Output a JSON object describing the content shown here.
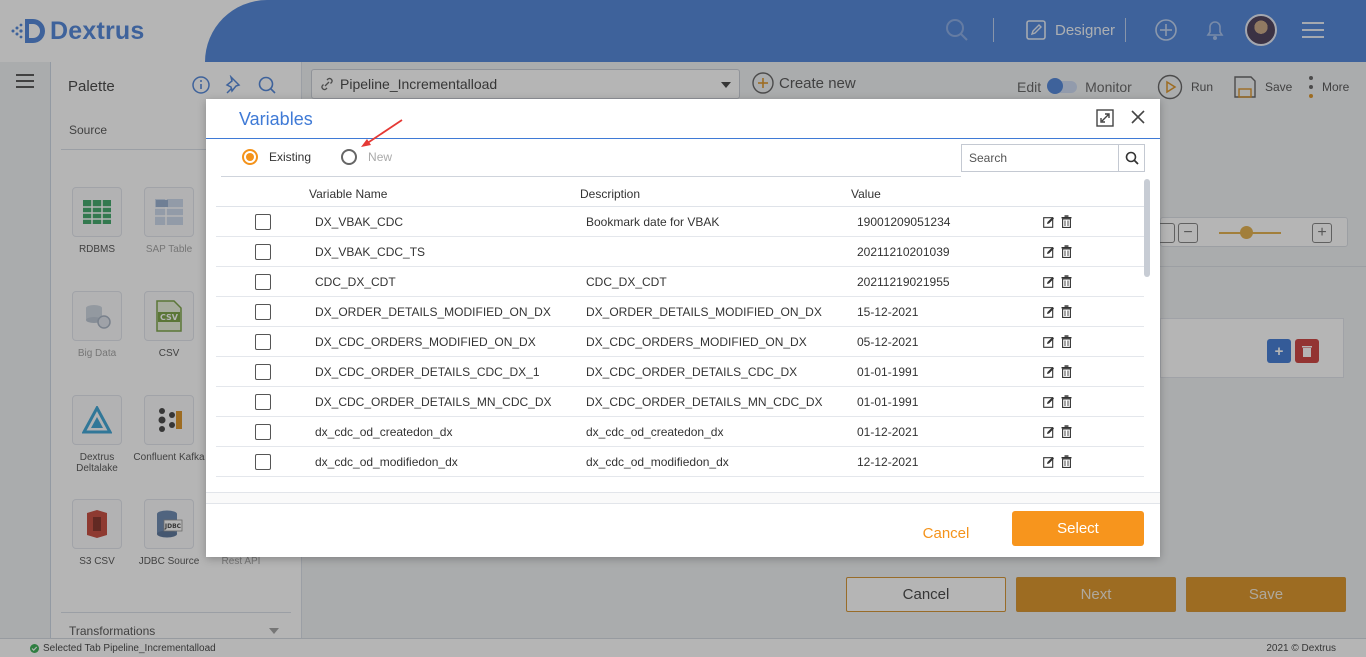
{
  "header": {
    "logo_text": "Dextrus",
    "designer_label": "Designer",
    "brand_color": "#3f7ad6"
  },
  "palette": {
    "title": "Palette",
    "source_label": "Source",
    "transformations_label": "Transformations",
    "tiles": [
      {
        "label": "RDBMS",
        "icon": "table-grid-icon"
      },
      {
        "label": "SAP Table",
        "icon": "sap-table-icon"
      },
      {
        "label": "Big Data",
        "icon": "big-data-icon"
      },
      {
        "label": "CSV",
        "icon": "csv-file-icon"
      },
      {
        "label": "Dextrus Deltalake",
        "icon": "deltalake-icon"
      },
      {
        "label": "Confluent Kafka",
        "icon": "kafka-icon"
      },
      {
        "label": "S3 CSV",
        "icon": "s3-icon"
      },
      {
        "label": "JDBC Source",
        "icon": "jdbc-icon"
      },
      {
        "label": "Rest API",
        "icon": "rest-api-icon"
      }
    ]
  },
  "toolbar": {
    "pipeline_name": "Pipeline_Incrementalload",
    "create_new": "Create new",
    "edit_label": "Edit",
    "monitor_label": "Monitor",
    "run_label": "Run",
    "save_label": "Save",
    "more_label": "More"
  },
  "page_buttons": {
    "cancel": "Cancel",
    "next": "Next",
    "save": "Save"
  },
  "status": {
    "left": "Selected Tab Pipeline_Incrementalload",
    "right": "2021 © Dextrus"
  },
  "modal": {
    "title": "Variables",
    "radio_existing": "Existing",
    "radio_new": "New",
    "search_placeholder": "Search",
    "columns": [
      "Variable Name",
      "Description",
      "Value"
    ],
    "rows": [
      {
        "name": "DX_VBAK_CDC",
        "description": "Bookmark date for VBAK",
        "value": "19001209051234"
      },
      {
        "name": "DX_VBAK_CDC_TS",
        "description": "",
        "value": "20211210201039"
      },
      {
        "name": "CDC_DX_CDT",
        "description": "CDC_DX_CDT",
        "value": "20211219021955"
      },
      {
        "name": "DX_ORDER_DETAILS_MODIFIED_ON_DX",
        "description": "DX_ORDER_DETAILS_MODIFIED_ON_DX",
        "value": "15-12-2021"
      },
      {
        "name": "DX_CDC_ORDERS_MODIFIED_ON_DX",
        "description": "DX_CDC_ORDERS_MODIFIED_ON_DX",
        "value": "05-12-2021"
      },
      {
        "name": "DX_CDC_ORDER_DETAILS_CDC_DX_1",
        "description": "DX_CDC_ORDER_DETAILS_CDC_DX",
        "value": "01-01-1991"
      },
      {
        "name": "DX_CDC_ORDER_DETAILS_MN_CDC_DX",
        "description": "DX_CDC_ORDER_DETAILS_MN_CDC_DX",
        "value": "01-01-1991"
      },
      {
        "name": "dx_cdc_od_createdon_dx",
        "description": "dx_cdc_od_createdon_dx",
        "value": "01-12-2021"
      },
      {
        "name": "dx_cdc_od_modifiedon_dx",
        "description": "dx_cdc_od_modifiedon_dx",
        "value": "12-12-2021"
      }
    ],
    "cancel_label": "Cancel",
    "select_label": "Select",
    "accent_color": "#f7951d"
  }
}
